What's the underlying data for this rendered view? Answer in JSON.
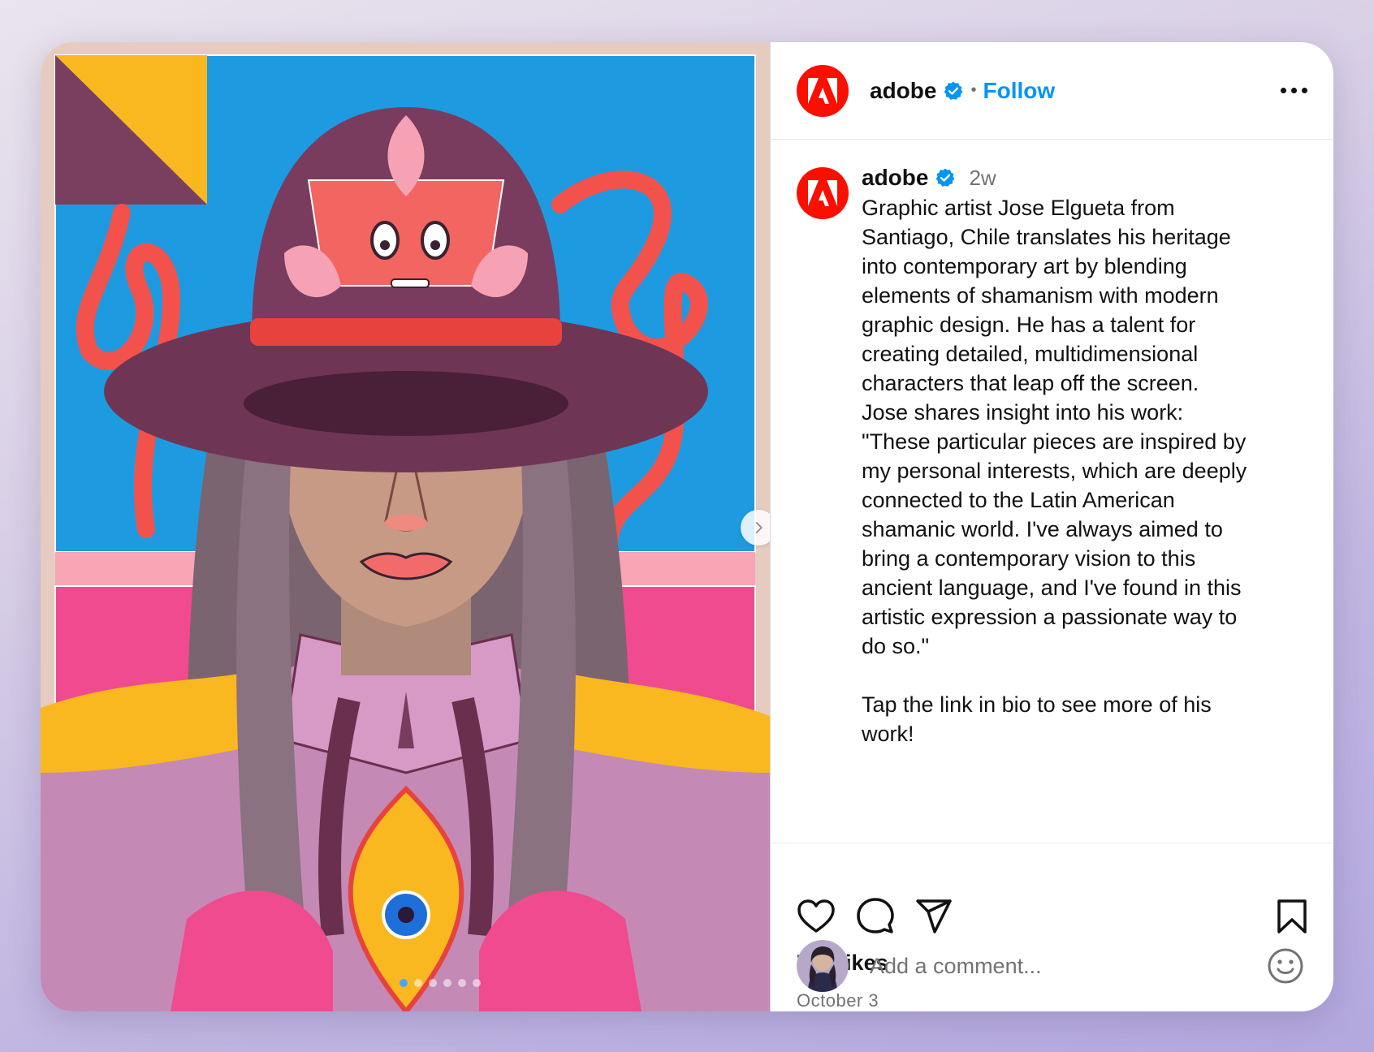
{
  "post": {
    "account": "adobe",
    "follow_label": "Follow",
    "separator": "•",
    "time_ago": "2w",
    "caption": "Graphic artist Jose Elgueta from\nSantiago, Chile translates his heritage\ninto contemporary art by blending\nelements of shamanism with modern\ngraphic design. He has a talent for\ncreating detailed, multidimensional\ncharacters that leap off the screen.\nJose shares insight into his work:\n\"These particular pieces are inspired by\nmy personal interests, which are deeply\nconnected to the Latin American\nshamanic world. I've always aimed to\nbring a contemporary vision to this\nancient language, and I've found in this\nartistic expression a passionate way to\ndo so.\"\n\nTap the link in bio to see more of his\nwork!",
    "likes": "745 likes",
    "date": "October 3"
  },
  "comment": {
    "placeholder": "Add a comment..."
  },
  "carousel": {
    "slide_count": 6,
    "active_index": 0
  },
  "icons": {
    "verified": "verified-badge-icon",
    "more": "more-options-icon",
    "like": "heart-icon",
    "comment": "comment-bubble-icon",
    "share": "share-paper-plane-icon",
    "save": "bookmark-icon",
    "emoji": "emoji-smile-icon",
    "next": "chevron-right-icon"
  },
  "colors": {
    "brand": "#fa0f00",
    "follow": "#0095f6",
    "verified": "#0095f6"
  }
}
